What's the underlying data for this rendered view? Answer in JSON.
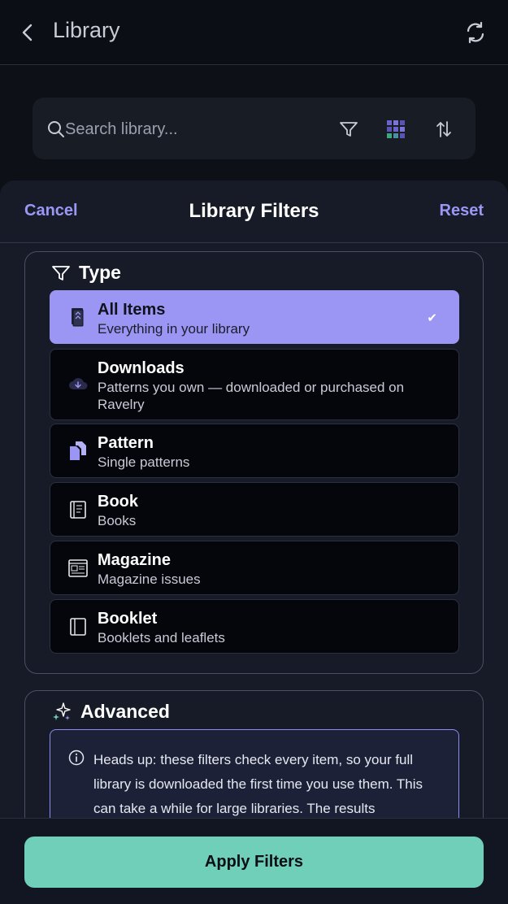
{
  "appbar": {
    "title": "Library"
  },
  "search": {
    "placeholder": "Search library..."
  },
  "sheet": {
    "cancel_label": "Cancel",
    "title": "Library Filters",
    "reset_label": "Reset"
  },
  "type_section": {
    "title": "Type",
    "options": [
      {
        "title": "All Items",
        "subtitle": "Everything in your library",
        "icon": "library-stack-icon",
        "selected": true
      },
      {
        "title": "Downloads",
        "subtitle": "Patterns you own — downloaded or purchased on Ravelry",
        "icon": "cloud-download-icon",
        "selected": false
      },
      {
        "title": "Pattern",
        "subtitle": "Single patterns",
        "icon": "pattern-files-icon",
        "selected": false
      },
      {
        "title": "Book",
        "subtitle": "Books",
        "icon": "book-icon",
        "selected": false
      },
      {
        "title": "Magazine",
        "subtitle": "Magazine issues",
        "icon": "magazine-icon",
        "selected": false
      },
      {
        "title": "Booklet",
        "subtitle": "Booklets and leaflets",
        "icon": "booklet-icon",
        "selected": false
      }
    ]
  },
  "advanced_section": {
    "title": "Advanced",
    "notice": "Heads up: these filters check every item, so your full library is downloaded the first time you use them. This can take a while for large libraries. The results"
  },
  "apply_label": "Apply Filters",
  "colors": {
    "accent": "#9b96f3",
    "apply_button": "#6fcfb9",
    "background": "#0d1017"
  }
}
